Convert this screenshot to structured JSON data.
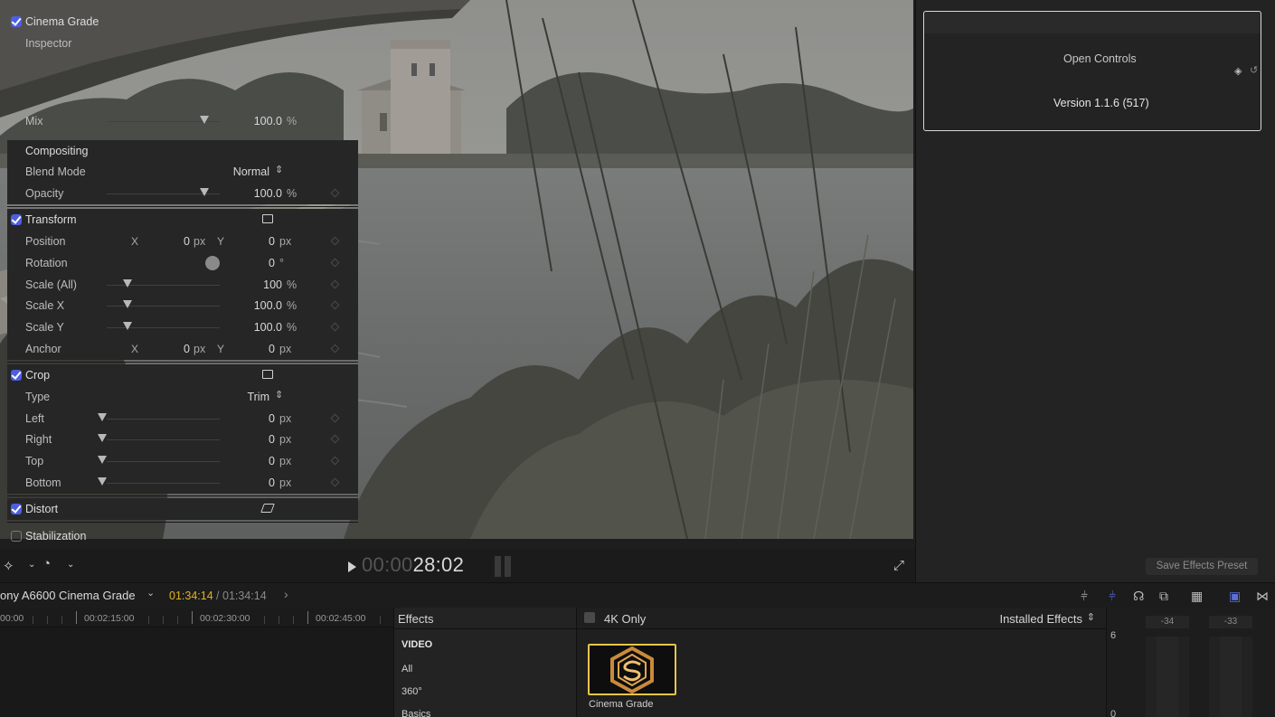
{
  "viewer": {
    "timecode_dim": "00:00",
    "timecode_main": "28:02"
  },
  "inspector": {
    "cinema_grade": {
      "title": "Cinema Grade",
      "inspector_label": "Inspector",
      "open_controls": "Open Controls",
      "version": "Version 1.1.6 (517)",
      "mix_label": "Mix",
      "mix_value": "100.0",
      "mix_unit": "%",
      "mix_fraction": 1.0
    },
    "compositing": {
      "title": "Compositing",
      "blend_label": "Blend Mode",
      "blend_value": "Normal",
      "opacity_label": "Opacity",
      "opacity_value": "100.0",
      "opacity_unit": "%",
      "opacity_fraction": 1.0
    },
    "transform": {
      "title": "Transform",
      "position_label": "Position",
      "position_x": "0",
      "position_y": "0",
      "rotation_label": "Rotation",
      "rotation_value": "0",
      "rotation_unit": "°",
      "scale_all_label": "Scale (All)",
      "scale_all_value": "100",
      "scale_x_label": "Scale X",
      "scale_x_value": "100.0",
      "scale_y_label": "Scale Y",
      "scale_y_value": "100.0",
      "anchor_label": "Anchor",
      "anchor_x": "0",
      "anchor_y": "0",
      "axis_x": "X",
      "axis_y": "Y",
      "unit_px": "px",
      "unit_pct": "%"
    },
    "crop": {
      "title": "Crop",
      "type_label": "Type",
      "type_value": "Trim",
      "left_label": "Left",
      "right_label": "Right",
      "top_label": "Top",
      "bottom_label": "Bottom",
      "zero": "0",
      "unit_px": "px"
    },
    "distort": {
      "title": "Distort"
    },
    "stabilization": {
      "title": "Stabilization"
    },
    "save_preset": "Save Effects Preset"
  },
  "project": {
    "name": "ony A6600 Cinema Grade",
    "timecode_current": "01:34:14",
    "separator": "/",
    "timecode_total": "01:34:14"
  },
  "ruler": {
    "labels": [
      "00:00",
      "00:02:15:00",
      "00:02:30:00",
      "00:02:45:00"
    ]
  },
  "effects_browser": {
    "title": "Effects",
    "categories": [
      "VIDEO",
      "All",
      "360°",
      "Basics"
    ],
    "filter_label": "4K Only",
    "source_label": "Installed Effects",
    "thumbnail_label": "Cinema Grade"
  },
  "meters": {
    "channel_left": "-34",
    "channel_right": "-33",
    "scale_top": "6",
    "scale_bottom": "0"
  },
  "colors": {
    "accent_checkbox": "#4d5fe0",
    "timecode_yellow": "#e0b321",
    "thumbnail_border": "#e7c54a"
  }
}
